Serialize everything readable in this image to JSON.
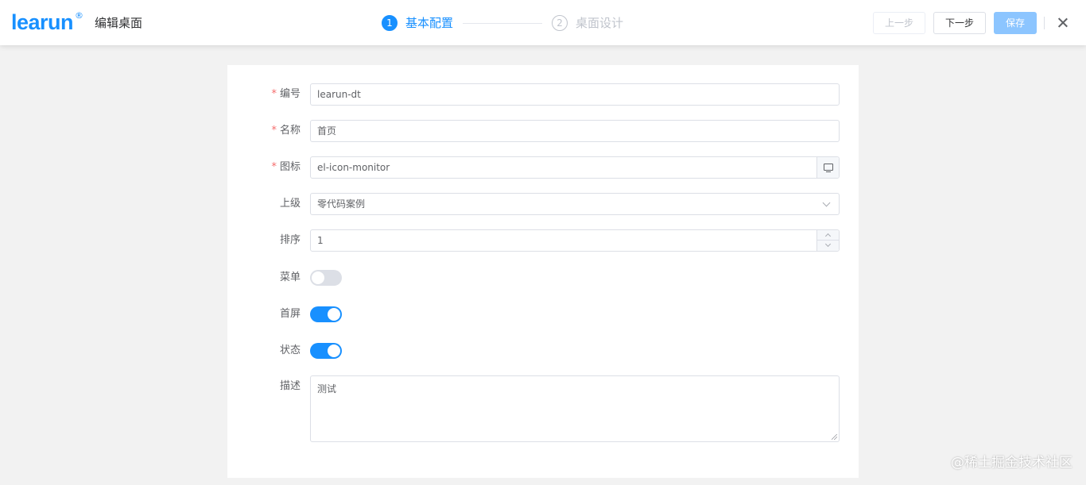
{
  "header": {
    "logo_text": "learun",
    "logo_reg": "®",
    "title": "编辑桌面"
  },
  "steps": [
    {
      "number": "1",
      "title": "基本配置",
      "state": "active"
    },
    {
      "number": "2",
      "title": "桌面设计",
      "state": "wait"
    }
  ],
  "actions": {
    "prev_label": "上一步",
    "next_label": "下一步",
    "save_label": "保存"
  },
  "form": {
    "code": {
      "label": "编号",
      "required": true,
      "value": "learun-dt"
    },
    "name": {
      "label": "名称",
      "required": true,
      "value": "首页"
    },
    "icon": {
      "label": "图标",
      "required": true,
      "value": "el-icon-monitor",
      "append_icon": "monitor-icon"
    },
    "parent": {
      "label": "上级",
      "value": "零代码案例"
    },
    "sort": {
      "label": "排序",
      "value": "1"
    },
    "menu": {
      "label": "菜单",
      "on": false
    },
    "home": {
      "label": "首屏",
      "on": true
    },
    "status": {
      "label": "状态",
      "on": true
    },
    "description": {
      "label": "描述",
      "value": "测试"
    }
  },
  "required_mark": "*",
  "watermark": "@稀土掘金技术社区",
  "colors": {
    "primary": "#1890ff",
    "primary_disabled": "#8cc5ff",
    "required": "#f56c6c",
    "switch_off": "#dcdfe6"
  }
}
